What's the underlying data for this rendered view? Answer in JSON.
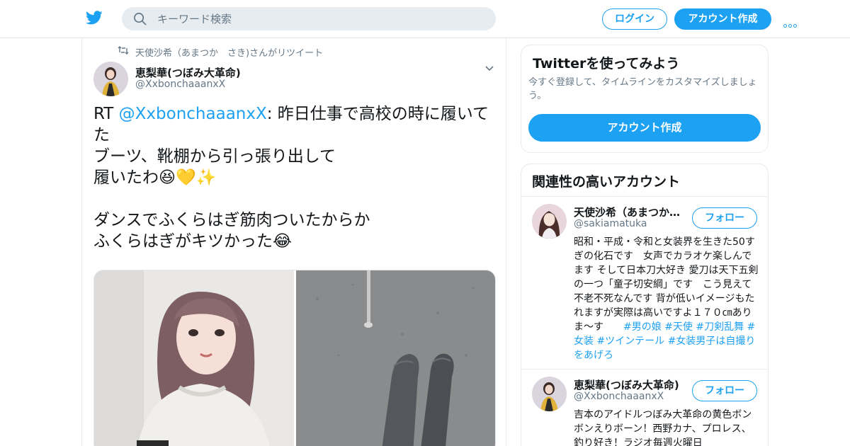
{
  "header": {
    "search_placeholder": "キーワード検索",
    "login_label": "ログイン",
    "signup_label": "アカウント作成",
    "brand_color": "#1da1f2"
  },
  "tweet": {
    "retweeted_by": "天使沙希（あまつか　さき)さんがリツイート",
    "author_name": "恵梨華(つぼみ大革命)",
    "author_handle": "@XxbonchaaanxX",
    "text_prefix": "RT ",
    "mention": "@XxbonchaaanxX",
    "text_rest": ": 昨日仕事で高校の時に履いてた\nブーツ、靴棚から引っ張り出して\n履いたわ😆💛✨\n\nダンスでふくらはぎ筋肉ついたからか\nふくらはぎがキツかった😂",
    "media": [
      "selfie-photo",
      "boots-photo"
    ]
  },
  "sidebar": {
    "try_card": {
      "title": "Twitterを使ってみよう",
      "description": "今すぐ登録して、タイムラインをカスタマイズしましょう。",
      "button_label": "アカウント作成"
    },
    "related": {
      "title": "関連性の高いアカウント",
      "follow_label": "フォロー",
      "accounts": [
        {
          "name": "天使沙希（あまつか…",
          "handle": "@sakiamatuka",
          "bio": "昭和・平成・令和と女装界を生きた50すぎの化石です　女声でカラオケ楽しんでます そして日本刀大好き 愛刀は天下五剣の一つ「童子切安綱」です　こう見えて不老不死なんです 背が低いイメージもたれますが実際は高いですよ１７０㎝ありま～す　　",
          "tags": "#男の娘 #天使 #刀剣乱舞 #女装 #ツインテール #女装男子は自撮りをあげろ"
        },
        {
          "name": "恵梨華(つぼみ大革命)",
          "handle": "@XxbonchaaanxX",
          "bio": "吉本のアイドルつぼみ大革命の黄色ボンボンえりボーン！西野カナ、プロレス、釣り好き！ラジオ毎週火曜日"
        }
      ]
    }
  }
}
